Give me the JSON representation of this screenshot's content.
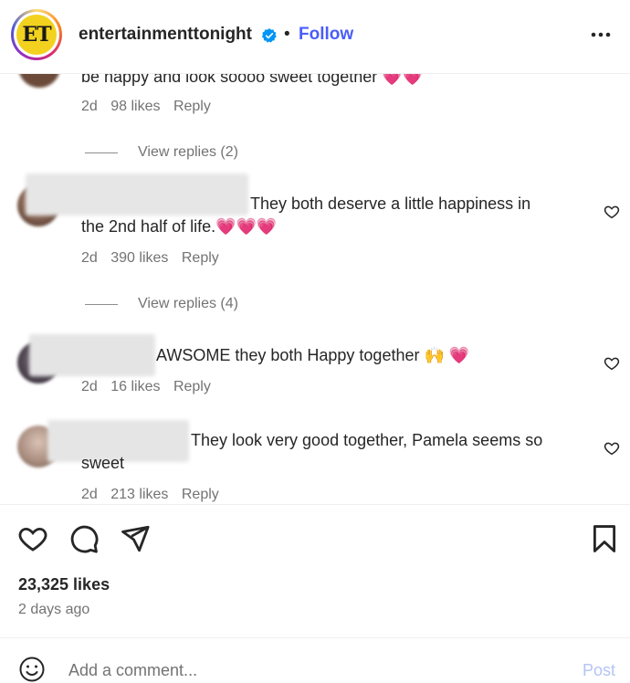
{
  "header": {
    "username": "entertainmenttonight",
    "logo_text": "ET",
    "separator": "•",
    "follow_label": "Follow"
  },
  "comments": [
    {
      "text": "be happy and look soooo sweet together 💗💗",
      "time": "2d",
      "likes": "98 likes",
      "reply": "Reply",
      "view_replies": "View replies (2)"
    },
    {
      "text_line1": "They both deserve a little happiness in",
      "text_line2": "the 2nd half of life.💗💗💗",
      "time": "2d",
      "likes": "390 likes",
      "reply": "Reply",
      "view_replies": "View replies (4)"
    },
    {
      "text": "AWSOME they both Happy together 🙌 💗",
      "time": "2d",
      "likes": "16 likes",
      "reply": "Reply"
    },
    {
      "text_line1": "They look very good together, Pamela seems so",
      "text_line2": "sweet",
      "time": "2d",
      "likes": "213 likes",
      "reply": "Reply"
    }
  ],
  "post": {
    "likes": "23,325 likes",
    "time_ago": "2 days ago"
  },
  "composer": {
    "placeholder": "Add a comment...",
    "post_label": "Post"
  },
  "colors": {
    "accent": "#4a5df9",
    "post_disabled": "#b3c4f5",
    "muted": "#737373"
  }
}
